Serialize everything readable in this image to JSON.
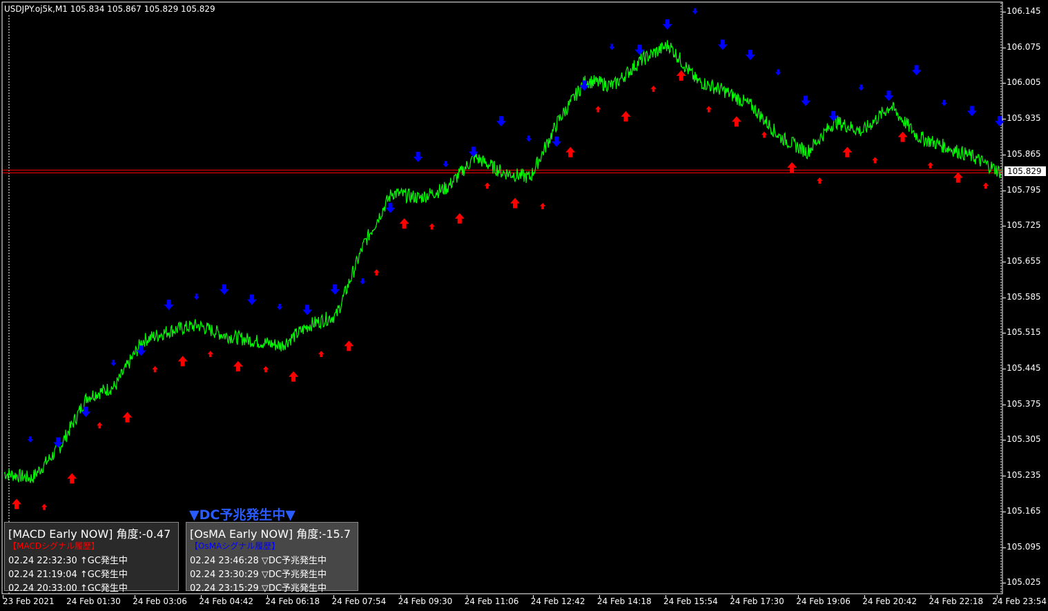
{
  "chart": {
    "symbol_label": "USDJPY.oj5k,M1  105.834 105.867 105.829 105.829",
    "current_price": "105.829",
    "price_ticks": [
      "106.145",
      "106.075",
      "106.005",
      "105.935",
      "105.865",
      "105.795",
      "105.725",
      "105.655",
      "105.585",
      "105.515",
      "105.445",
      "105.375",
      "105.305",
      "105.235",
      "105.165",
      "105.095",
      "105.025"
    ],
    "time_ticks": [
      "23 Feb 2021",
      "24 Feb 01:30",
      "24 Feb 03:06",
      "24 Feb 04:42",
      "24 Feb 06:18",
      "24 Feb 07:54",
      "24 Feb 09:30",
      "24 Feb 11:06",
      "24 Feb 12:42",
      "24 Feb 14:18",
      "24 Feb 15:54",
      "24 Feb 17:30",
      "24 Feb 19:06",
      "24 Feb 20:42",
      "24 Feb 22:18",
      "24 Feb 23:54"
    ],
    "colors": {
      "background": "#000000",
      "price_line": "#00ff00",
      "bid_line": "#ff0000",
      "buy_arrow": "#ff0000",
      "sell_arrow": "#0000ff",
      "axis": "#ffffff"
    }
  },
  "banner": {
    "text": "▼DC予兆発生中▼"
  },
  "macd_panel": {
    "title": "[MACD Early NOW] 角度:-0.47",
    "subtitle": "【MACDシグナル履歴】",
    "subtitle_color": "#ff0000",
    "rows": [
      "02.24 22:32:30 ↑GC発生中",
      "02.24 21:19:04 ↑GC発生中",
      "02.24 20:33:00 ↑GC発生中"
    ]
  },
  "osma_panel": {
    "title": "[OsMA Early NOW] 角度:-15.7",
    "subtitle": "【OsMAシグナル履歴】",
    "subtitle_color": "#0000ff",
    "rows": [
      "02.24 23:46:28 ▽DC予兆発生中",
      "02.24 23:30:29 ▽DC予兆発生中",
      "02.24 23:15:29 ▽DC予兆発生中"
    ]
  },
  "chart_data": {
    "type": "line",
    "title": "USDJPY.oj5k,M1  105.834 105.867 105.829 105.829",
    "xlabel": "",
    "ylabel": "",
    "ylim": [
      105.0,
      106.16
    ],
    "x": [
      "23 Feb 2021",
      "24 Feb 01:30",
      "24 Feb 03:06",
      "24 Feb 04:42",
      "24 Feb 06:18",
      "24 Feb 07:54",
      "24 Feb 09:30",
      "24 Feb 11:06",
      "24 Feb 12:42",
      "24 Feb 14:18",
      "24 Feb 15:54",
      "24 Feb 17:30",
      "24 Feb 19:06",
      "24 Feb 20:42",
      "24 Feb 22:18",
      "24 Feb 23:54"
    ],
    "series": [
      {
        "values": [
          105.24,
          105.23,
          105.29,
          105.39,
          105.41,
          105.5,
          105.52,
          105.53,
          105.51,
          105.5,
          105.49,
          105.53,
          105.55,
          105.69,
          105.79,
          105.78,
          105.8,
          105.86,
          105.83,
          105.82,
          105.93,
          106.01,
          106.0,
          106.05,
          106.08,
          106.01,
          105.99,
          105.96,
          105.9,
          105.87,
          105.93,
          105.91,
          105.96,
          105.9,
          105.88,
          105.86,
          105.83
        ]
      }
    ],
    "x_step_minutes": 40,
    "grid": false,
    "legend": "none"
  }
}
